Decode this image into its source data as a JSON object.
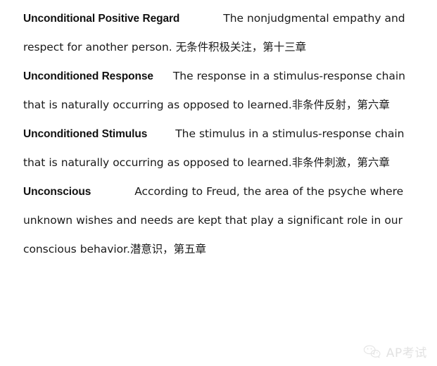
{
  "document": {
    "type": "glossary",
    "entries": [
      {
        "term": "Unconditional Positive Regard",
        "definition": "The nonjudgmental empathy and respect for another person.",
        "translation": "无条件积极关注",
        "separator": "，",
        "chapter": "第十三章",
        "definition_with_translation": "The nonjudgmental empathy and respect for another person.  无条件积极关注，第十三章"
      },
      {
        "term": "Unconditioned Response",
        "definition": "The response in a stimulus-response chain that is naturally occurring as opposed to learned.",
        "translation": "非条件反射",
        "separator": "，",
        "chapter": "第六章",
        "definition_with_translation": "The response in a stimulus-response chain that is naturally occurring as opposed to learned.非条件反射，第六章"
      },
      {
        "term": "Unconditioned Stimulus",
        "definition": "The stimulus in a stimulus-response chain that is naturally occurring as opposed to learned.",
        "translation": "非条件刺激",
        "separator": "，",
        "chapter": "第六章",
        "definition_with_translation": "The stimulus in a stimulus-response chain that is naturally occurring as opposed to learned.非条件刺激，第六章"
      },
      {
        "term": "Unconscious",
        "definition": "According to Freud, the area of the psyche where unknown wishes and needs are kept that play a significant role in our conscious behavior.",
        "translation": "潜意识",
        "separator": "，",
        "chapter": "第五章",
        "definition_with_translation": "According to Freud, the area of the psyche where unknown wishes and needs are kept that play a significant role in our conscious behavior.潜意识，第五章"
      }
    ]
  },
  "watermark": {
    "icon": "wechat-icon",
    "text": "AP考试",
    "color": "#e2e2e2"
  },
  "colors": {
    "background": "#ffffff",
    "text": "#1a1a1a",
    "term": "#111111",
    "watermark": "#e2e2e2"
  }
}
